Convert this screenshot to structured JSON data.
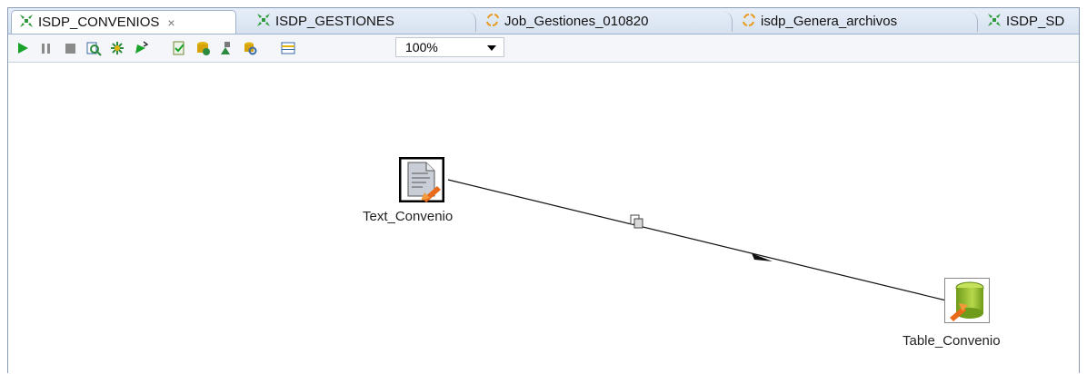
{
  "tabs": [
    {
      "label": "ISDP_CONVENIOS",
      "icon": "transformation-icon",
      "active": true,
      "close": "×"
    },
    {
      "label": "ISDP_GESTIONES",
      "icon": "transformation-icon",
      "active": false
    },
    {
      "label": "Job_Gestiones_010820",
      "icon": "job-icon",
      "active": false
    },
    {
      "label": "isdp_Genera_archivos",
      "icon": "job-icon",
      "active": false
    },
    {
      "label": "ISDP_SD",
      "icon": "transformation-icon",
      "active": false
    }
  ],
  "toolbar": {
    "zoom_value": "100%",
    "buttons": [
      "run-icon",
      "pause-icon",
      "stop-icon",
      "preview-icon",
      "debug-icon",
      "replay-icon",
      "verify-icon",
      "impact-icon",
      "sql-icon",
      "explore-db-icon",
      "show-results-icon"
    ]
  },
  "canvas": {
    "steps": [
      {
        "label": "Text_Convenio",
        "icon": "text-file-input-icon"
      },
      {
        "label": "Table_Convenio",
        "icon": "table-output-icon"
      }
    ],
    "hop": {
      "from": "Text_Convenio",
      "to": "Table_Convenio",
      "hop_icon": "copy-rows-icon"
    }
  },
  "colors": {
    "tab_bg": "#d7e2f0",
    "transformation_icon": "#2e9a3c",
    "job_icon": "#e89a1c",
    "run_green": "#1aa32a"
  }
}
